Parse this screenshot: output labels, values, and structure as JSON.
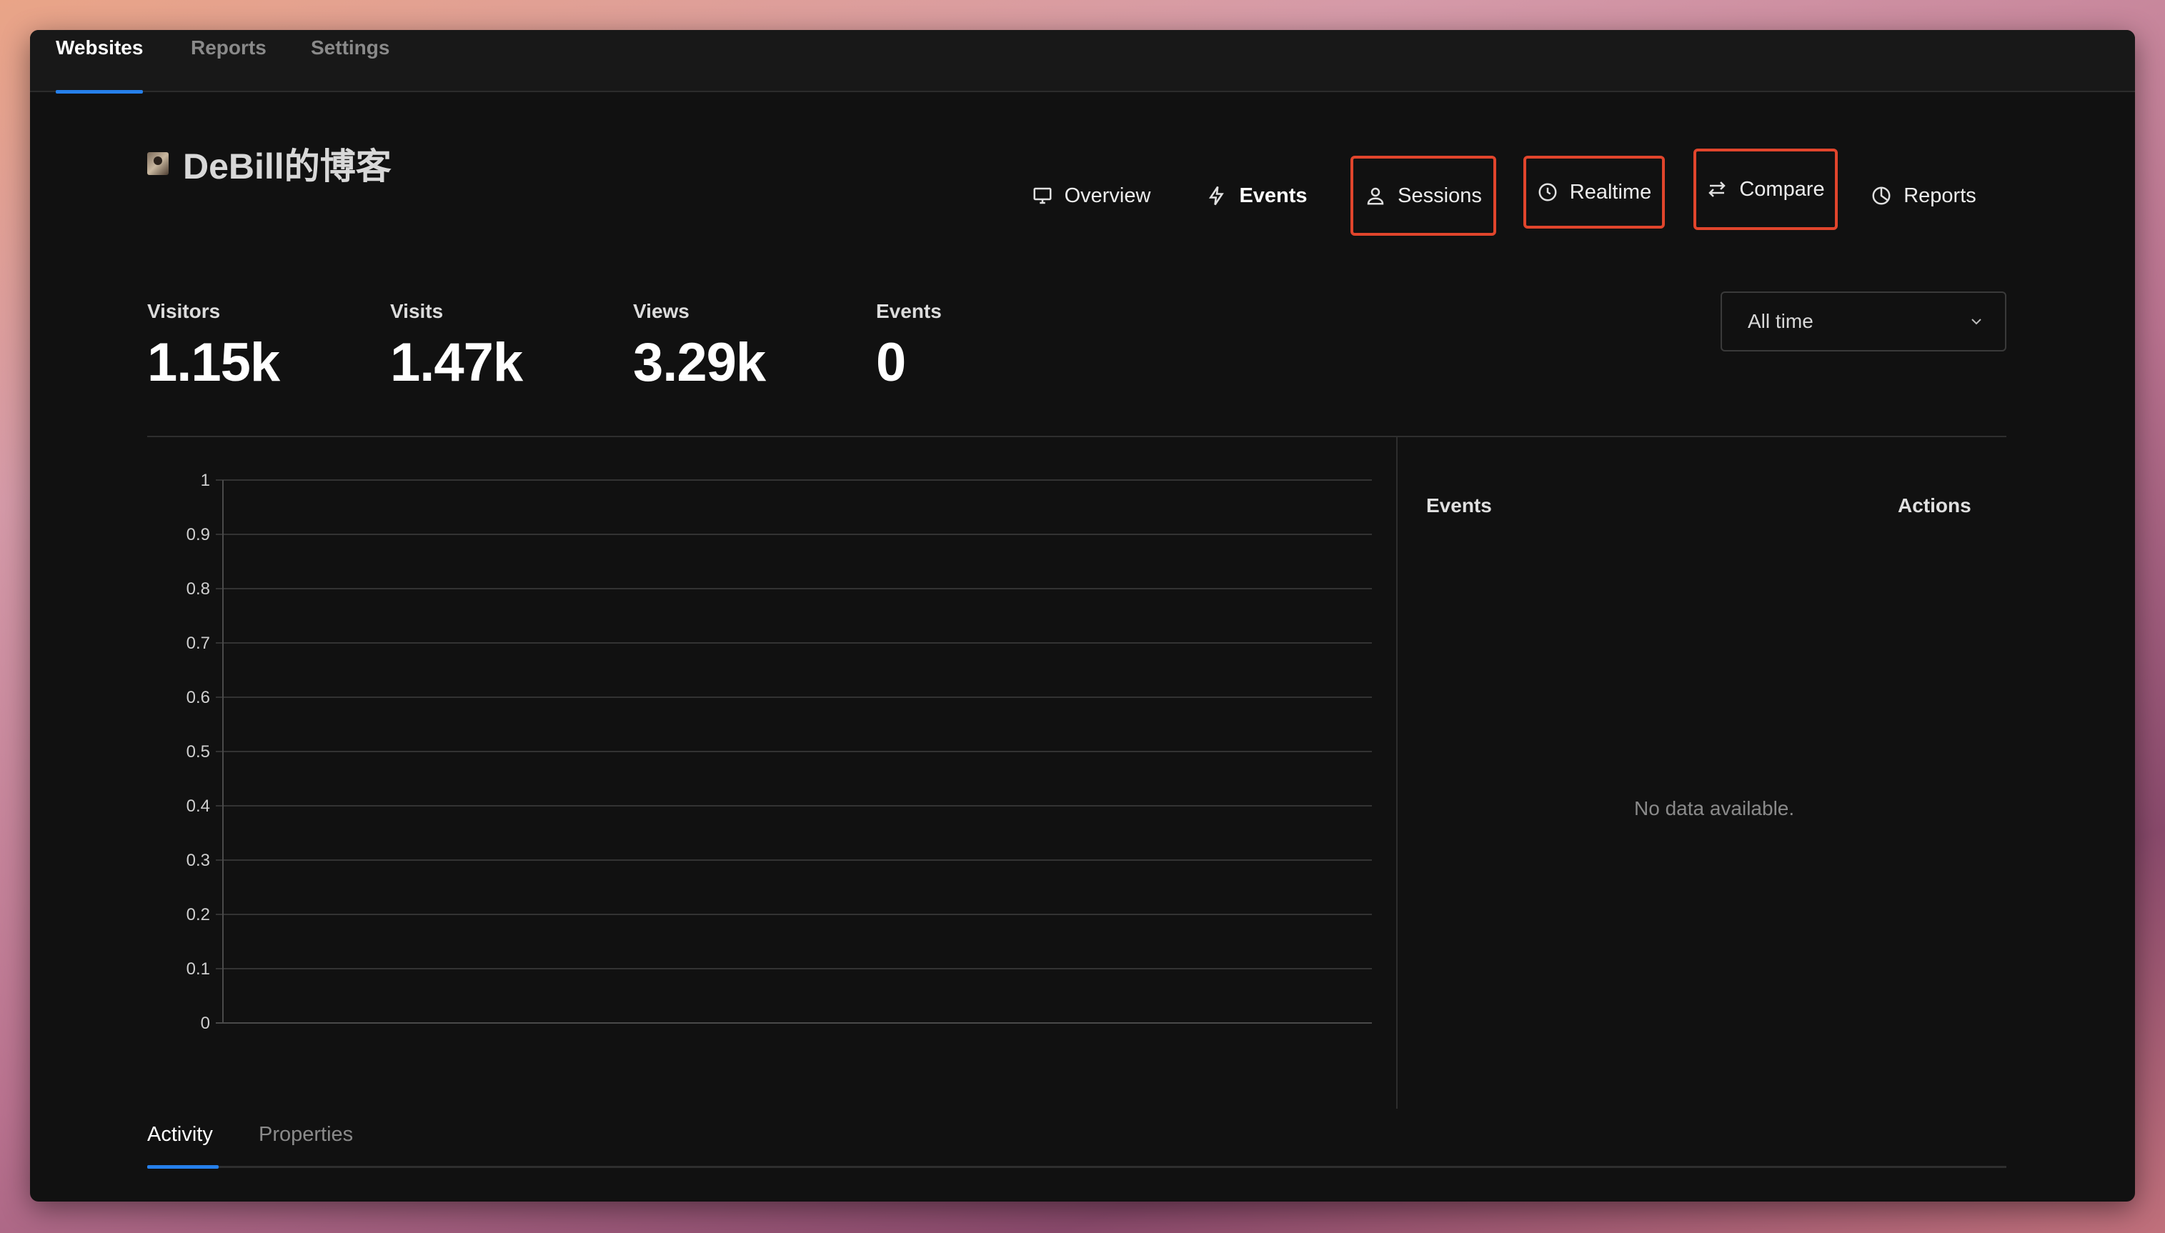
{
  "topnav": {
    "items": [
      {
        "label": "Websites",
        "active": true
      },
      {
        "label": "Reports",
        "active": false
      },
      {
        "label": "Settings",
        "active": false
      }
    ]
  },
  "site": {
    "title": "DeBill的博客"
  },
  "tabs": [
    {
      "label": "Overview",
      "icon": "monitor-icon"
    },
    {
      "label": "Events",
      "icon": "lightning-icon"
    },
    {
      "label": "Sessions",
      "icon": "user-icon"
    },
    {
      "label": "Realtime",
      "icon": "clock-icon"
    },
    {
      "label": "Compare",
      "icon": "arrows-swap-icon"
    },
    {
      "label": "Reports",
      "icon": "pie-chart-icon"
    }
  ],
  "metrics": [
    {
      "label": "Visitors",
      "value": "1.15k"
    },
    {
      "label": "Visits",
      "value": "1.47k"
    },
    {
      "label": "Views",
      "value": "3.29k"
    },
    {
      "label": "Events",
      "value": "0"
    }
  ],
  "date_range": {
    "selected": "All time"
  },
  "chart_data": {
    "type": "bar",
    "categories": [],
    "series": [],
    "ylim": [
      0,
      1
    ],
    "yticks": [
      "0",
      "0.1",
      "0.2",
      "0.3",
      "0.4",
      "0.5",
      "0.6",
      "0.7",
      "0.8",
      "0.9",
      "1"
    ],
    "grid": true
  },
  "events_panel": {
    "col_events": "Events",
    "col_actions": "Actions",
    "empty_text": "No data available."
  },
  "bottom_tabs": [
    {
      "label": "Activity",
      "active": true
    },
    {
      "label": "Properties",
      "active": false
    }
  ],
  "colors": {
    "accent": "#2680eb",
    "highlight_box": "#e1452c",
    "background": "#111111"
  }
}
